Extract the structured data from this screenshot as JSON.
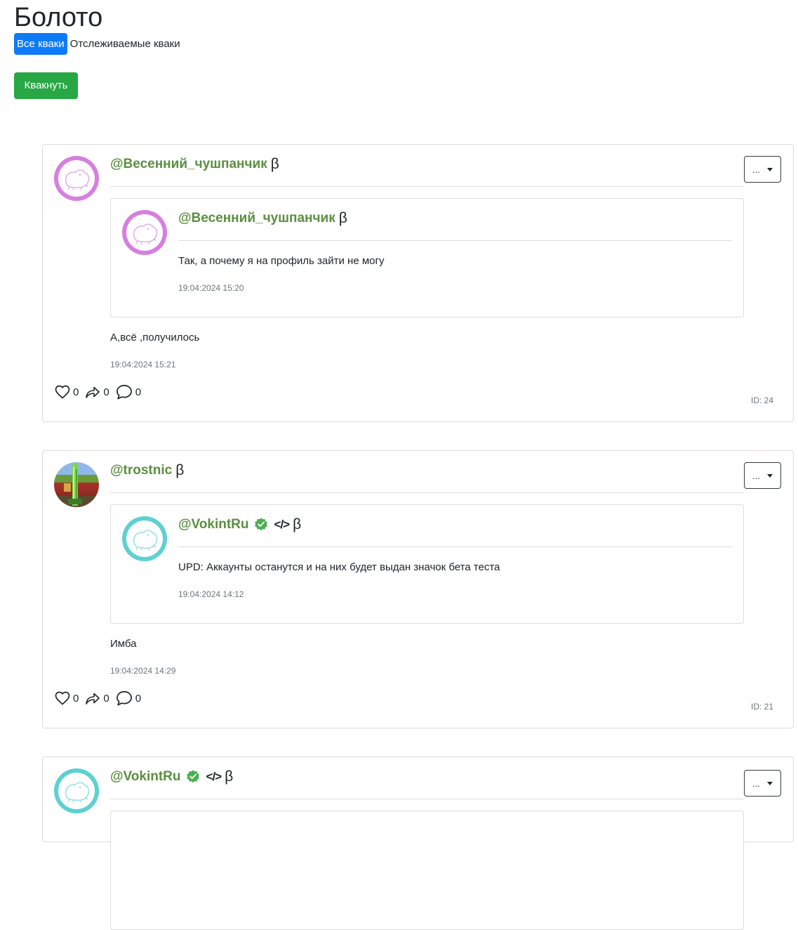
{
  "page": {
    "title": "Болото"
  },
  "tabs": [
    {
      "label": "Все кваки",
      "active": true
    },
    {
      "label": "Отслеживаемые кваки",
      "active": false
    }
  ],
  "post_button": {
    "label": "Квакнуть"
  },
  "colors": {
    "accent_blue": "#0d7bf8",
    "success_green": "#28a745",
    "username_green": "#5a8f3f",
    "verified_green": "#4caf50"
  },
  "posts": [
    {
      "author": "@Весенний_чушпанчик",
      "beta": "β",
      "menu_label": "...",
      "quote": {
        "author": "@Весенний_чушпанчик",
        "beta": "β",
        "text": "Так, а почему я на профиль зайти не могу",
        "date": "19:04:2024 15:20"
      },
      "text": "А,всё ,получилось",
      "date": "19:04:2024 15:21",
      "likes": "0",
      "reposts": "0",
      "comments": "0",
      "id": "ID: 24"
    },
    {
      "author": "@trostnic",
      "beta": "β",
      "menu_label": "...",
      "quote": {
        "author": "@VokintRu",
        "beta": "β",
        "code_badge": "</>",
        "text": "UPD: Аккаунты останутся и на них будет выдан значок бета теста",
        "date": "19:04:2024 14:12"
      },
      "text": "Имба",
      "date": "19:04:2024 14:29",
      "likes": "0",
      "reposts": "0",
      "comments": "0",
      "id": "ID: 21"
    },
    {
      "author": "@VokintRu",
      "beta": "β",
      "code_badge": "</>",
      "menu_label": "..."
    }
  ]
}
